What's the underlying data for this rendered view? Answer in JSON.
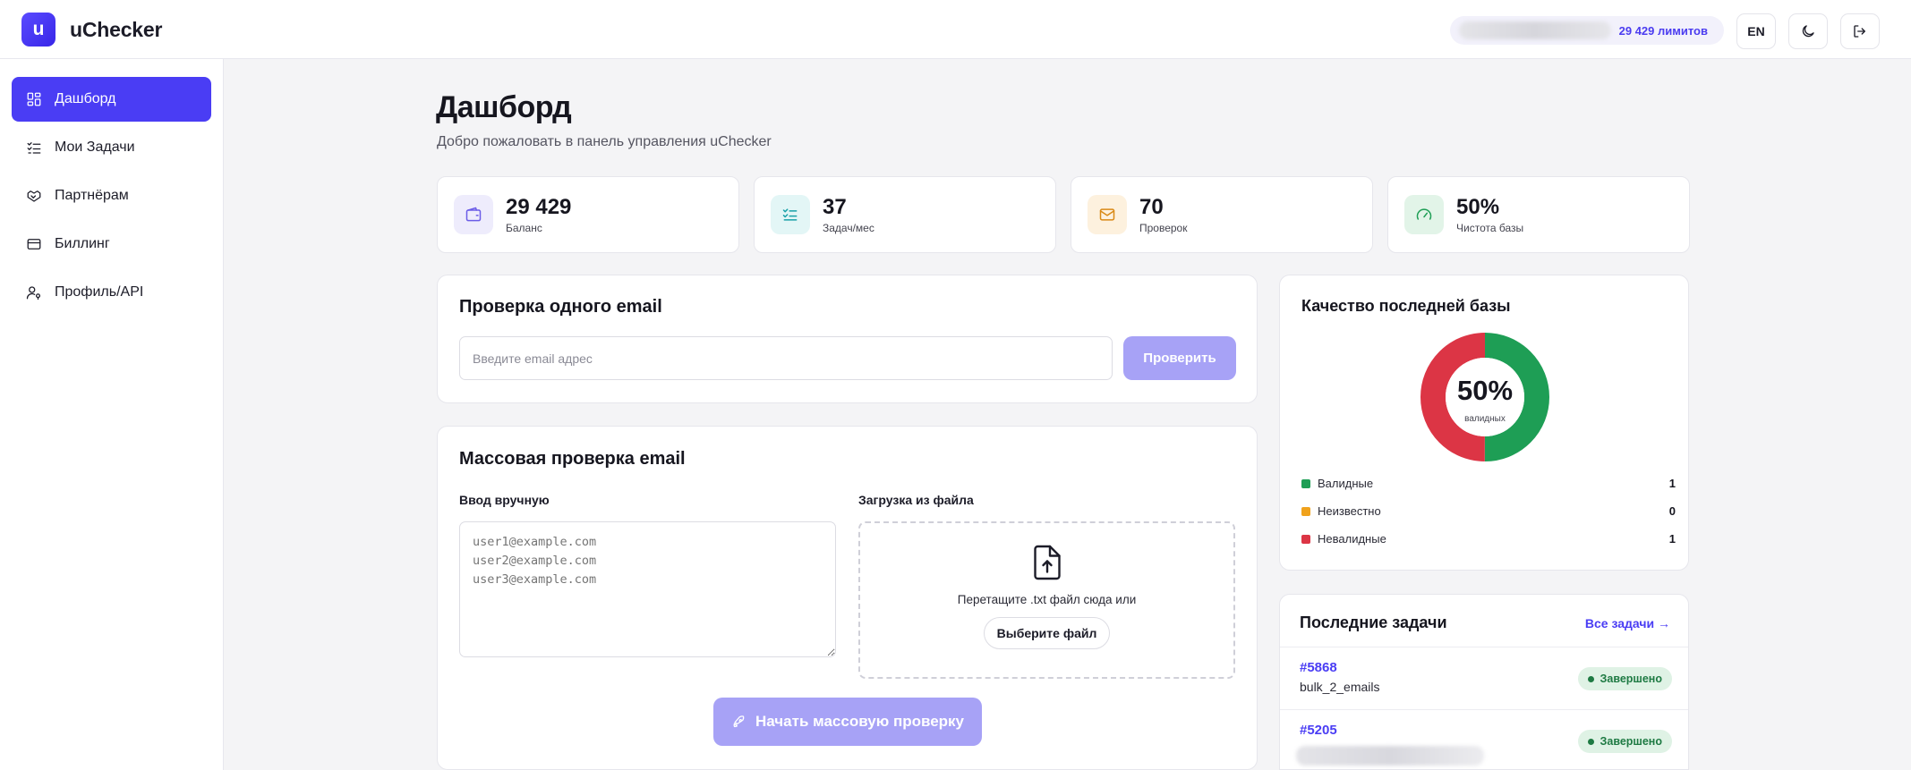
{
  "app": {
    "logo_letter": "u",
    "name": "uChecker"
  },
  "header": {
    "limits": "29 429 лимитов",
    "lang_button": "EN"
  },
  "sidebar": {
    "items": [
      {
        "label": "Дашборд",
        "icon": "dashboard-icon",
        "active": true
      },
      {
        "label": "Мои Задачи",
        "icon": "tasks-icon"
      },
      {
        "label": "Партнёрам",
        "icon": "handshake-icon"
      },
      {
        "label": "Биллинг",
        "icon": "card-icon"
      },
      {
        "label": "Профиль/API",
        "icon": "user-key-icon"
      }
    ]
  },
  "page": {
    "title": "Дашборд",
    "subtitle": "Добро пожаловать в панель управления uChecker"
  },
  "stats": [
    {
      "value": "29 429",
      "label": "Баланс",
      "icon": "wallet-icon",
      "color": "#6b5ce7",
      "bg": "#eeecfc"
    },
    {
      "value": "37",
      "label": "Задач/мес",
      "icon": "checklist-icon",
      "color": "#1aa1a8",
      "bg": "#e3f6f6"
    },
    {
      "value": "70",
      "label": "Проверок",
      "icon": "mail-icon",
      "color": "#d98a17",
      "bg": "#fdf1de"
    },
    {
      "value": "50%",
      "label": "Чистота базы",
      "icon": "gauge-icon",
      "color": "#1e9e55",
      "bg": "#e2f4e8"
    }
  ],
  "single_check": {
    "title": "Проверка одного email",
    "placeholder": "Введите email адрес",
    "button": "Проверить"
  },
  "bulk_check": {
    "title": "Массовая проверка email",
    "manual_label": "Ввод вручную",
    "manual_placeholder": "user1@example.com\nuser2@example.com\nuser3@example.com",
    "file_label": "Загрузка из файла",
    "drop_text": "Перетащите .txt файл сюда или",
    "file_button": "Выберите файл",
    "start_button": "Начать массовую проверку"
  },
  "quality": {
    "title": "Качество последней базы",
    "percent_label": "50%",
    "caption": "валидных",
    "legend": [
      {
        "label": "Валидные",
        "value": 1,
        "color": "#1e9e55"
      },
      {
        "label": "Неизвестно",
        "value": 0,
        "color": "#f0a21c"
      },
      {
        "label": "Невалидные",
        "value": 1,
        "color": "#dc3545"
      }
    ]
  },
  "recent_tasks": {
    "title": "Последние задачи",
    "all_link": "Все задачи →",
    "items": [
      {
        "id": "#5868",
        "name": "bulk_2_emails",
        "status": "Завершено"
      },
      {
        "id": "#5205",
        "name": "",
        "status": "Завершено"
      }
    ]
  },
  "colors": {
    "accent": "#4a3df4",
    "accent_disabled": "#a7a2f6",
    "valid": "#1e9e55",
    "invalid": "#dc3545"
  }
}
